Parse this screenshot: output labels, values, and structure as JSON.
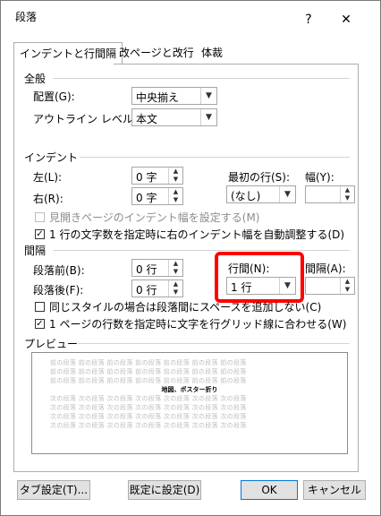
{
  "dialog": {
    "title": "段落",
    "help": "?",
    "close": "✕"
  },
  "tabs": [
    {
      "label": "インデントと行間隔",
      "active": true
    },
    {
      "label": "改ページと改行",
      "active": false
    },
    {
      "label": "体裁",
      "active": false
    }
  ],
  "general": {
    "section": "全般",
    "alignment_label": "配置(G):",
    "alignment_value": "中央揃え",
    "outline_label": "アウトライン レベル(O):",
    "outline_value": "本文"
  },
  "indent": {
    "section": "インデント",
    "left_label": "左(L):",
    "left_value": "0 字",
    "right_label": "右(R):",
    "right_value": "0 字",
    "first_line_label": "最初の行(S):",
    "first_line_value": "(なし)",
    "width_label": "幅(Y):",
    "width_value": "",
    "mirror_label": "見開きページのインデント幅を設定する(M)",
    "mirror_checked": false,
    "auto_adjust_label": "1 行の文字数を指定時に右のインデント幅を自動調整する(D)",
    "auto_adjust_checked": true
  },
  "spacing": {
    "section": "間隔",
    "before_label": "段落前(B):",
    "before_value": "0 行",
    "after_label": "段落後(F):",
    "after_value": "0 行",
    "line_spacing_label": "行間(N):",
    "line_spacing_value": "1 行",
    "at_label": "間隔(A):",
    "at_value": "",
    "no_space_label": "同じスタイルの場合は段落間にスペースを追加しない(C)",
    "no_space_checked": false,
    "grid_label": "1 ページの行数を指定時に文字を行グリッド線に合わせる(W)",
    "grid_checked": true
  },
  "preview": {
    "section": "プレビュー",
    "prev_text": "前の段落 前の段落 前の段落 前の段落 前の段落 前の段落 前の段落",
    "current_text": "地図、ポスター折り",
    "next_text": "次の段落 次の段落 次の段落 次の段落 次の段落 次の段落 次の段落"
  },
  "buttons": {
    "tabs": "タブ設定(T)...",
    "default": "既定に設定(D)",
    "ok": "OK",
    "cancel": "キャンセル"
  },
  "colors": {
    "highlight": "#ff0000",
    "default_button_border": "#0078d7"
  }
}
